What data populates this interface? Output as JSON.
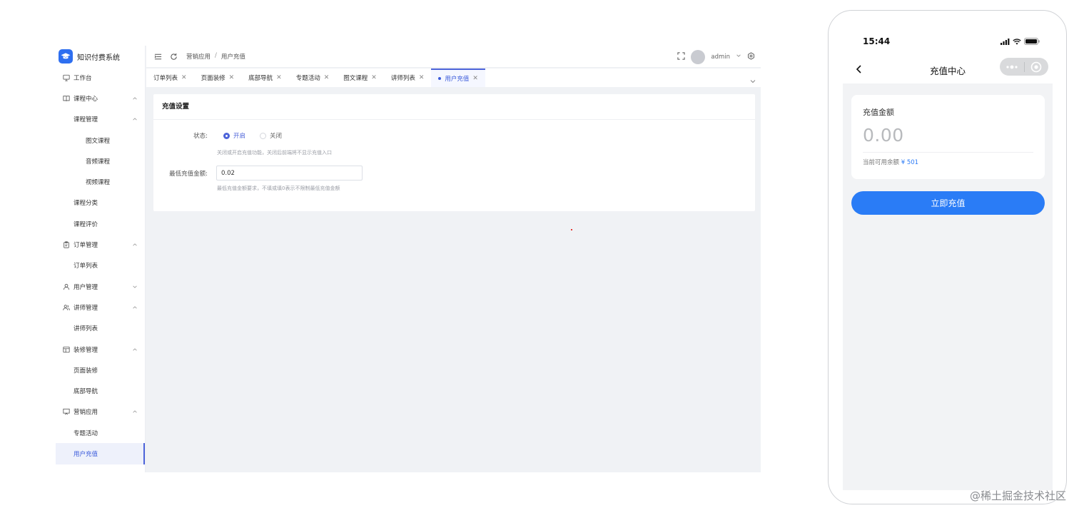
{
  "admin": {
    "brand": "知识付费系统",
    "sidebar": {
      "items": [
        {
          "label": "工作台",
          "level": 1,
          "icon": "monitor-icon",
          "arrow": ""
        },
        {
          "label": "课程中心",
          "level": 1,
          "icon": "book-icon",
          "arrow": "up"
        },
        {
          "label": "课程管理",
          "level": 2,
          "icon": "",
          "arrow": "up"
        },
        {
          "label": "图文课程",
          "level": 3,
          "icon": "",
          "arrow": ""
        },
        {
          "label": "音频课程",
          "level": 3,
          "icon": "",
          "arrow": ""
        },
        {
          "label": "视频课程",
          "level": 3,
          "icon": "",
          "arrow": ""
        },
        {
          "label": "课程分类",
          "level": 2,
          "icon": "",
          "arrow": ""
        },
        {
          "label": "课程评价",
          "level": 2,
          "icon": "",
          "arrow": ""
        },
        {
          "label": "订单管理",
          "level": 1,
          "icon": "clipboard-icon",
          "arrow": "up"
        },
        {
          "label": "订单列表",
          "level": 2,
          "icon": "",
          "arrow": ""
        },
        {
          "label": "用户管理",
          "level": 1,
          "icon": "user-icon",
          "arrow": "down"
        },
        {
          "label": "讲师管理",
          "level": 1,
          "icon": "users-icon",
          "arrow": "up"
        },
        {
          "label": "讲师列表",
          "level": 2,
          "icon": "",
          "arrow": ""
        },
        {
          "label": "装修管理",
          "level": 1,
          "icon": "layout-icon",
          "arrow": "up"
        },
        {
          "label": "页面装修",
          "level": 2,
          "icon": "",
          "arrow": ""
        },
        {
          "label": "底部导航",
          "level": 2,
          "icon": "",
          "arrow": ""
        },
        {
          "label": "营销应用",
          "level": 1,
          "icon": "presentation-icon",
          "arrow": "up"
        },
        {
          "label": "专题活动",
          "level": 2,
          "icon": "",
          "arrow": ""
        },
        {
          "label": "用户充值",
          "level": 2,
          "icon": "",
          "arrow": "",
          "active": true
        }
      ]
    },
    "breadcrumb": [
      "营销应用",
      "用户充值"
    ],
    "breadcrumb_sep": "/",
    "user": "admin",
    "tabs": [
      {
        "label": "订单列表"
      },
      {
        "label": "页面装修"
      },
      {
        "label": "底部导航"
      },
      {
        "label": "专题活动"
      },
      {
        "label": "图文课程"
      },
      {
        "label": "讲师列表"
      },
      {
        "label": "用户充值",
        "active": true
      }
    ],
    "tab_close": "✕",
    "card": {
      "title": "充值设置",
      "status_label": "状态:",
      "status_on": "开启",
      "status_off": "关闭",
      "status_help": "关闭或开启充值功能，关闭后前端将不显示充值入口",
      "min_label": "最低充值金额:",
      "min_value": "0.02",
      "min_help": "最低充值金额要求，不填或填0表示不限制最低充值金额"
    }
  },
  "phone": {
    "time": "15:44",
    "title": "充值中心",
    "amount_label": "充值金额",
    "amount_value": "0.00",
    "balance_prefix": "当前可用余额",
    "balance_value": "¥ 501",
    "button": "立即充值"
  },
  "watermark": "@稀土掘金技术社区",
  "colors": {
    "accent": "#4c63d9",
    "phone_button": "#2a7cf6",
    "logo": "#2e6ff0"
  }
}
